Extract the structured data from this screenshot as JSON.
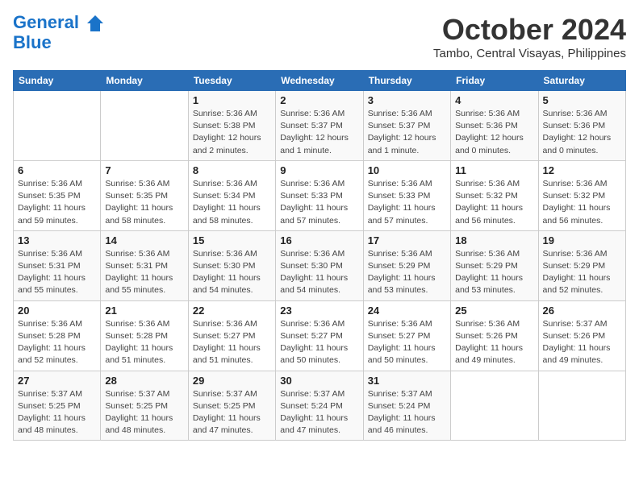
{
  "header": {
    "logo_line1": "General",
    "logo_line2": "Blue",
    "month": "October 2024",
    "location": "Tambo, Central Visayas, Philippines"
  },
  "days_of_week": [
    "Sunday",
    "Monday",
    "Tuesday",
    "Wednesday",
    "Thursday",
    "Friday",
    "Saturday"
  ],
  "weeks": [
    [
      {
        "day": "",
        "info": ""
      },
      {
        "day": "",
        "info": ""
      },
      {
        "day": "1",
        "info": "Sunrise: 5:36 AM\nSunset: 5:38 PM\nDaylight: 12 hours\nand 2 minutes."
      },
      {
        "day": "2",
        "info": "Sunrise: 5:36 AM\nSunset: 5:37 PM\nDaylight: 12 hours\nand 1 minute."
      },
      {
        "day": "3",
        "info": "Sunrise: 5:36 AM\nSunset: 5:37 PM\nDaylight: 12 hours\nand 1 minute."
      },
      {
        "day": "4",
        "info": "Sunrise: 5:36 AM\nSunset: 5:36 PM\nDaylight: 12 hours\nand 0 minutes."
      },
      {
        "day": "5",
        "info": "Sunrise: 5:36 AM\nSunset: 5:36 PM\nDaylight: 12 hours\nand 0 minutes."
      }
    ],
    [
      {
        "day": "6",
        "info": "Sunrise: 5:36 AM\nSunset: 5:35 PM\nDaylight: 11 hours\nand 59 minutes."
      },
      {
        "day": "7",
        "info": "Sunrise: 5:36 AM\nSunset: 5:35 PM\nDaylight: 11 hours\nand 58 minutes."
      },
      {
        "day": "8",
        "info": "Sunrise: 5:36 AM\nSunset: 5:34 PM\nDaylight: 11 hours\nand 58 minutes."
      },
      {
        "day": "9",
        "info": "Sunrise: 5:36 AM\nSunset: 5:33 PM\nDaylight: 11 hours\nand 57 minutes."
      },
      {
        "day": "10",
        "info": "Sunrise: 5:36 AM\nSunset: 5:33 PM\nDaylight: 11 hours\nand 57 minutes."
      },
      {
        "day": "11",
        "info": "Sunrise: 5:36 AM\nSunset: 5:32 PM\nDaylight: 11 hours\nand 56 minutes."
      },
      {
        "day": "12",
        "info": "Sunrise: 5:36 AM\nSunset: 5:32 PM\nDaylight: 11 hours\nand 56 minutes."
      }
    ],
    [
      {
        "day": "13",
        "info": "Sunrise: 5:36 AM\nSunset: 5:31 PM\nDaylight: 11 hours\nand 55 minutes."
      },
      {
        "day": "14",
        "info": "Sunrise: 5:36 AM\nSunset: 5:31 PM\nDaylight: 11 hours\nand 55 minutes."
      },
      {
        "day": "15",
        "info": "Sunrise: 5:36 AM\nSunset: 5:30 PM\nDaylight: 11 hours\nand 54 minutes."
      },
      {
        "day": "16",
        "info": "Sunrise: 5:36 AM\nSunset: 5:30 PM\nDaylight: 11 hours\nand 54 minutes."
      },
      {
        "day": "17",
        "info": "Sunrise: 5:36 AM\nSunset: 5:29 PM\nDaylight: 11 hours\nand 53 minutes."
      },
      {
        "day": "18",
        "info": "Sunrise: 5:36 AM\nSunset: 5:29 PM\nDaylight: 11 hours\nand 53 minutes."
      },
      {
        "day": "19",
        "info": "Sunrise: 5:36 AM\nSunset: 5:29 PM\nDaylight: 11 hours\nand 52 minutes."
      }
    ],
    [
      {
        "day": "20",
        "info": "Sunrise: 5:36 AM\nSunset: 5:28 PM\nDaylight: 11 hours\nand 52 minutes."
      },
      {
        "day": "21",
        "info": "Sunrise: 5:36 AM\nSunset: 5:28 PM\nDaylight: 11 hours\nand 51 minutes."
      },
      {
        "day": "22",
        "info": "Sunrise: 5:36 AM\nSunset: 5:27 PM\nDaylight: 11 hours\nand 51 minutes."
      },
      {
        "day": "23",
        "info": "Sunrise: 5:36 AM\nSunset: 5:27 PM\nDaylight: 11 hours\nand 50 minutes."
      },
      {
        "day": "24",
        "info": "Sunrise: 5:36 AM\nSunset: 5:27 PM\nDaylight: 11 hours\nand 50 minutes."
      },
      {
        "day": "25",
        "info": "Sunrise: 5:36 AM\nSunset: 5:26 PM\nDaylight: 11 hours\nand 49 minutes."
      },
      {
        "day": "26",
        "info": "Sunrise: 5:37 AM\nSunset: 5:26 PM\nDaylight: 11 hours\nand 49 minutes."
      }
    ],
    [
      {
        "day": "27",
        "info": "Sunrise: 5:37 AM\nSunset: 5:25 PM\nDaylight: 11 hours\nand 48 minutes."
      },
      {
        "day": "28",
        "info": "Sunrise: 5:37 AM\nSunset: 5:25 PM\nDaylight: 11 hours\nand 48 minutes."
      },
      {
        "day": "29",
        "info": "Sunrise: 5:37 AM\nSunset: 5:25 PM\nDaylight: 11 hours\nand 47 minutes."
      },
      {
        "day": "30",
        "info": "Sunrise: 5:37 AM\nSunset: 5:24 PM\nDaylight: 11 hours\nand 47 minutes."
      },
      {
        "day": "31",
        "info": "Sunrise: 5:37 AM\nSunset: 5:24 PM\nDaylight: 11 hours\nand 46 minutes."
      },
      {
        "day": "",
        "info": ""
      },
      {
        "day": "",
        "info": ""
      }
    ]
  ]
}
